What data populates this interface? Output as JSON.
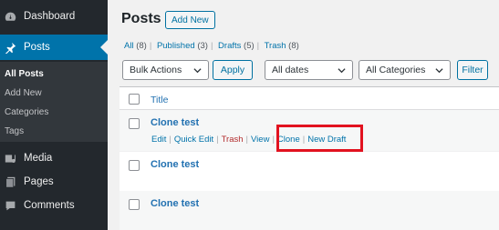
{
  "sidebar": {
    "items": [
      {
        "label": "Dashboard",
        "icon": "dashboard-icon"
      },
      {
        "label": "Posts",
        "icon": "pushpin-icon",
        "active": true
      },
      {
        "label": "Media",
        "icon": "media-icon"
      },
      {
        "label": "Pages",
        "icon": "pages-icon"
      },
      {
        "label": "Comments",
        "icon": "comments-icon"
      }
    ],
    "submenu": [
      "All Posts",
      "Add New",
      "Categories",
      "Tags"
    ]
  },
  "header": {
    "title": "Posts",
    "add_new": "Add New"
  },
  "views": [
    {
      "label": "All",
      "count": "(8)"
    },
    {
      "label": "Published",
      "count": "(3)"
    },
    {
      "label": "Drafts",
      "count": "(5)"
    },
    {
      "label": "Trash",
      "count": "(8)"
    }
  ],
  "views_separator": "|",
  "filters": {
    "bulk_actions": "Bulk Actions",
    "apply": "Apply",
    "dates": "All dates",
    "categories": "All Categories",
    "filter": "Filter"
  },
  "table": {
    "column_title": "Title",
    "rows": [
      {
        "title": "Clone test"
      },
      {
        "title": "Clone test"
      },
      {
        "title": "Clone test"
      }
    ],
    "row_actions": [
      "Edit",
      "Quick Edit",
      "Trash",
      "View",
      "Clone",
      "New Draft"
    ],
    "row_actions_separator": "|"
  },
  "colors": {
    "sidebar_bg": "#23282d",
    "active_bg": "#0073aa",
    "link": "#0073aa",
    "trash": "#b32d2e",
    "highlight": "#e2121f"
  }
}
